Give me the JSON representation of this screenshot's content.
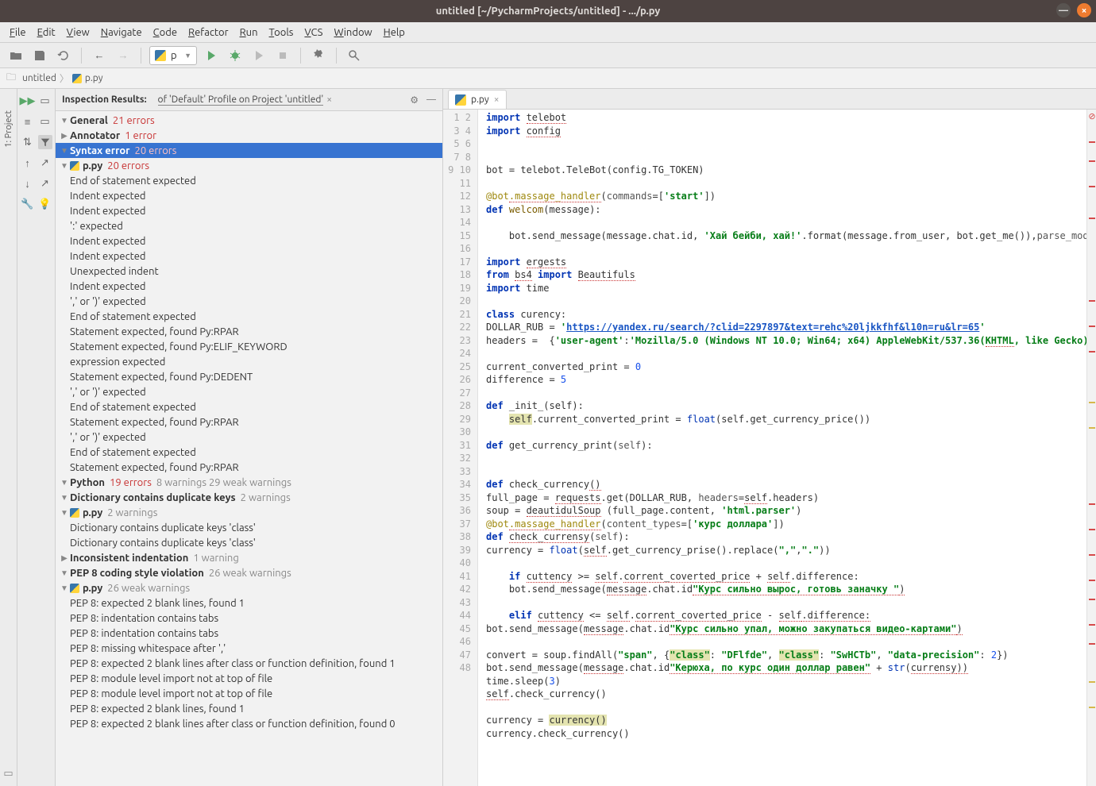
{
  "window": {
    "title": "untitled [~/PycharmProjects/untitled] - .../p.py"
  },
  "menu": [
    "File",
    "Edit",
    "View",
    "Navigate",
    "Code",
    "Refactor",
    "Run",
    "Tools",
    "VCS",
    "Window",
    "Help"
  ],
  "runConfig": "p",
  "breadcrumbs": [
    {
      "type": "folder",
      "label": "untitled"
    },
    {
      "type": "py",
      "label": "p.py"
    }
  ],
  "sidebar": {
    "project_tab": "1: Project"
  },
  "inspection": {
    "title": "Inspection Results:",
    "profile": "of 'Default' Profile on Project 'untitled'",
    "tree": [
      {
        "depth": 0,
        "arrow": "down",
        "label": "General",
        "err": "21 errors"
      },
      {
        "depth": 1,
        "arrow": "right",
        "label": "Annotator",
        "err": "1 error"
      },
      {
        "depth": 1,
        "arrow": "down",
        "label": "Syntax error",
        "err": "20 errors",
        "selected": true
      },
      {
        "depth": 2,
        "arrow": "down",
        "icon": "py",
        "label": "p.py",
        "err": "20 errors"
      },
      {
        "depth": 3,
        "label": "End of statement expected"
      },
      {
        "depth": 3,
        "label": "Indent expected"
      },
      {
        "depth": 3,
        "label": "Indent expected"
      },
      {
        "depth": 3,
        "label": "':' expected"
      },
      {
        "depth": 3,
        "label": "Indent expected"
      },
      {
        "depth": 3,
        "label": "Indent expected"
      },
      {
        "depth": 3,
        "label": "Unexpected indent"
      },
      {
        "depth": 3,
        "label": "Indent expected"
      },
      {
        "depth": 3,
        "label": "',' or ')' expected"
      },
      {
        "depth": 3,
        "label": "End of statement expected"
      },
      {
        "depth": 3,
        "label": "Statement expected, found Py:RPAR"
      },
      {
        "depth": 3,
        "label": "Statement expected, found Py:ELIF_KEYWORD"
      },
      {
        "depth": 3,
        "label": "expression expected"
      },
      {
        "depth": 3,
        "label": "Statement expected, found Py:DEDENT"
      },
      {
        "depth": 3,
        "label": "',' or ')' expected"
      },
      {
        "depth": 3,
        "label": "End of statement expected"
      },
      {
        "depth": 3,
        "label": "Statement expected, found Py:RPAR"
      },
      {
        "depth": 3,
        "label": "',' or ')' expected"
      },
      {
        "depth": 3,
        "label": "End of statement expected"
      },
      {
        "depth": 3,
        "label": "Statement expected, found Py:RPAR"
      },
      {
        "depth": 0,
        "arrow": "down",
        "label": "Python",
        "err": "19 errors",
        "warn": "8 warnings 29 weak warnings"
      },
      {
        "depth": 1,
        "arrow": "down",
        "label": "Dictionary contains duplicate keys",
        "warn": "2 warnings"
      },
      {
        "depth": 2,
        "arrow": "down",
        "icon": "py",
        "label": "p.py",
        "warn": "2 warnings"
      },
      {
        "depth": 3,
        "label": "Dictionary contains duplicate keys 'class'"
      },
      {
        "depth": 3,
        "label": "Dictionary contains duplicate keys 'class'"
      },
      {
        "depth": 1,
        "arrow": "right",
        "label": "Inconsistent indentation",
        "warn": "1 warning"
      },
      {
        "depth": 1,
        "arrow": "down",
        "label": "PEP 8 coding style violation",
        "warn": "26 weak warnings"
      },
      {
        "depth": 2,
        "arrow": "down",
        "icon": "py",
        "label": "p.py",
        "warn": "26 weak warnings"
      },
      {
        "depth": 3,
        "label": "PEP 8: expected 2 blank lines, found 1"
      },
      {
        "depth": 3,
        "label": "PEP 8: indentation contains tabs"
      },
      {
        "depth": 3,
        "label": "PEP 8: indentation contains tabs"
      },
      {
        "depth": 3,
        "label": "PEP 8: missing whitespace after ','"
      },
      {
        "depth": 3,
        "label": "PEP 8: expected 2 blank lines after class or function definition, found 1"
      },
      {
        "depth": 3,
        "label": "PEP 8: module level import not at top of file"
      },
      {
        "depth": 3,
        "label": "PEP 8: module level import not at top of file"
      },
      {
        "depth": 3,
        "label": "PEP 8: expected 2 blank lines, found 1"
      },
      {
        "depth": 3,
        "label": "PEP 8: expected 2 blank lines after class or function definition, found 0"
      }
    ]
  },
  "editor": {
    "tab": "p.py",
    "lines": [
      [
        {
          "t": "import ",
          "c": "kw"
        },
        {
          "t": "telebot",
          "c": "sq"
        }
      ],
      [
        {
          "t": "import ",
          "c": "kw"
        },
        {
          "t": "config",
          "c": "sq"
        }
      ],
      [],
      [],
      [
        {
          "t": "bot = telebot.TeleBot(config.TG_TOKEN)"
        }
      ],
      [],
      [
        {
          "t": "@bot",
          "c": "dec"
        },
        {
          "t": ".massage_handler",
          "c": "dec sq"
        },
        {
          "t": "(",
          "c": ""
        },
        {
          "t": "commands",
          "c": "op"
        },
        {
          "t": "=["
        },
        {
          "t": "'start'",
          "c": "str"
        },
        {
          "t": "])"
        }
      ],
      [
        {
          "t": "def ",
          "c": "kw"
        },
        {
          "t": "welcom",
          "c": "fn"
        },
        {
          "t": "(message):"
        }
      ],
      [],
      [
        {
          "t": "    bot.send_message(message.chat.id, "
        },
        {
          "t": "'Хай бейби, хай!'",
          "c": "ru"
        },
        {
          "t": ".format(message.from_user, bot.get_me()),"
        },
        {
          "t": "parse_mod",
          "c": "op"
        }
      ],
      [],
      [
        {
          "t": "import ",
          "c": "kw"
        },
        {
          "t": "ergests",
          "c": "sq"
        }
      ],
      [
        {
          "t": "from ",
          "c": "kw"
        },
        {
          "t": "bs4",
          "c": "sq"
        },
        {
          "t": " import ",
          "c": "kw"
        },
        {
          "t": "Beautifuls",
          "c": "sq"
        }
      ],
      [
        {
          "t": "import ",
          "c": "kw"
        },
        {
          "t": "time"
        }
      ],
      [],
      [
        {
          "t": "class ",
          "c": "kw"
        },
        {
          "t": "curency:"
        }
      ],
      [
        {
          "t": "DOLLAR_RUB = "
        },
        {
          "t": "'",
          "c": "str"
        },
        {
          "t": "https://yandex.ru/search/?clid=2297897&text=rehc%20ljkkfhf&l10n=ru&lr=65",
          "c": "link"
        },
        {
          "t": "'",
          "c": "str"
        }
      ],
      [
        {
          "t": "headers =  {"
        },
        {
          "t": "'user-agent'",
          "c": "str"
        },
        {
          "t": ":"
        },
        {
          "t": "'Mozilla/5.0 (Windows NT 10.0; Win64; x64) AppleWebKit/537.36(",
          "c": "str"
        },
        {
          "t": "KHTML",
          "c": "str sq"
        },
        {
          "t": ", like Gecko)",
          "c": "str"
        }
      ],
      [],
      [
        {
          "t": "current_converted_print = "
        },
        {
          "t": "0",
          "c": "num"
        }
      ],
      [
        {
          "t": "difference = "
        },
        {
          "t": "5",
          "c": "num"
        }
      ],
      [],
      [
        {
          "t": "def ",
          "c": "kw"
        },
        {
          "t": "_init_",
          "c": ""
        },
        {
          "t": "(self):"
        }
      ],
      [
        {
          "t": "    "
        },
        {
          "t": "self",
          "c": "hl"
        },
        {
          "t": ".current_converted_print = "
        },
        {
          "t": "float",
          "c": "bi"
        },
        {
          "t": "(self.get_currency_price())"
        }
      ],
      [],
      [
        {
          "t": "def ",
          "c": "kw"
        },
        {
          "t": "get_currency_print",
          "c": ""
        },
        {
          "t": "("
        },
        {
          "t": "self",
          "c": "op"
        },
        {
          "t": "):"
        }
      ],
      [],
      [],
      [
        {
          "t": "def ",
          "c": "kw"
        },
        {
          "t": "check_currency",
          "c": ""
        },
        {
          "t": "()",
          "c": "sq"
        }
      ],
      [
        {
          "t": "full_page = "
        },
        {
          "t": "requests",
          "c": "sq"
        },
        {
          "t": ".get(DOLLAR_RUB, "
        },
        {
          "t": "headers",
          "c": "op"
        },
        {
          "t": "="
        },
        {
          "t": "self",
          "c": "sq"
        },
        {
          "t": ".headers)"
        }
      ],
      [
        {
          "t": "soup = "
        },
        {
          "t": "deautidulSoup",
          "c": "sq"
        },
        {
          "t": " (full_page.content, "
        },
        {
          "t": "'html.parser'",
          "c": "str"
        },
        {
          "t": ")"
        }
      ],
      [
        {
          "t": "@bot",
          "c": "dec"
        },
        {
          "t": ".massage_handler",
          "c": "dec sq"
        },
        {
          "t": "("
        },
        {
          "t": "content_types",
          "c": "op"
        },
        {
          "t": "=["
        },
        {
          "t": "'курс доллара'",
          "c": "ru"
        },
        {
          "t": "])"
        }
      ],
      [
        {
          "t": "def ",
          "c": "kw"
        },
        {
          "t": "check_currensy",
          "c": "sq"
        },
        {
          "t": "("
        },
        {
          "t": "self",
          "c": "op"
        },
        {
          "t": "):"
        }
      ],
      [
        {
          "t": "currency = "
        },
        {
          "t": "float",
          "c": "bi"
        },
        {
          "t": "("
        },
        {
          "t": "self",
          "c": "sq"
        },
        {
          "t": ".get_currency_prise().replace("
        },
        {
          "t": "\",\"",
          "c": "str"
        },
        {
          "t": ","
        },
        {
          "t": "\".\"",
          "c": "str"
        },
        {
          "t": "))"
        }
      ],
      [],
      [
        {
          "t": "    if ",
          "c": "kw"
        },
        {
          "t": "cuttency",
          "c": "sq"
        },
        {
          "t": " >= "
        },
        {
          "t": "self",
          "c": "sq"
        },
        {
          "t": "."
        },
        {
          "t": "corrent_coverted_price",
          "c": "sq"
        },
        {
          "t": " + "
        },
        {
          "t": "self",
          "c": "sq"
        },
        {
          "t": ".difference:"
        }
      ],
      [
        {
          "t": "    bot.send_message("
        },
        {
          "t": "message",
          "c": "sq"
        },
        {
          "t": ".chat.id"
        },
        {
          "t": "\"Курс сильно вырос, готовь заначку \"",
          "c": "ru sq"
        },
        {
          "t": ")",
          "c": "sq"
        }
      ],
      [],
      [
        {
          "t": "    elif ",
          "c": "kw"
        },
        {
          "t": "cuttency",
          "c": "sq"
        },
        {
          "t": " <= "
        },
        {
          "t": "self",
          "c": "sq"
        },
        {
          "t": "."
        },
        {
          "t": "corrent_coverted_price",
          "c": "sq"
        },
        {
          "t": " - "
        },
        {
          "t": "self",
          "c": "sq"
        },
        {
          "t": ".difference:",
          "c": "sq"
        }
      ],
      [
        {
          "t": "bot.send_message("
        },
        {
          "t": "message",
          "c": "sq"
        },
        {
          "t": ".chat.id"
        },
        {
          "t": "\"Курс сильно упал, можно закупаться видео-картами\"",
          "c": "ru sq"
        },
        {
          "t": ")",
          "c": "sq"
        }
      ],
      [],
      [
        {
          "t": "convert = soup.findAll("
        },
        {
          "t": "\"span\"",
          "c": "str"
        },
        {
          "t": ", {"
        },
        {
          "t": "\"class\"",
          "c": "str hl"
        },
        {
          "t": ": "
        },
        {
          "t": "\"DFlfde\"",
          "c": "str"
        },
        {
          "t": ", "
        },
        {
          "t": "\"class\"",
          "c": "str hl"
        },
        {
          "t": ": "
        },
        {
          "t": "\"SwHCTb\"",
          "c": "str"
        },
        {
          "t": ", "
        },
        {
          "t": "\"data-precision\"",
          "c": "str"
        },
        {
          "t": ": "
        },
        {
          "t": "2",
          "c": "num"
        },
        {
          "t": "})"
        }
      ],
      [
        {
          "t": "bot.send_message("
        },
        {
          "t": "message",
          "c": "sq"
        },
        {
          "t": ".chat.id"
        },
        {
          "t": "\"Керюха, по курс один доллар равен\"",
          "c": "ru sq"
        },
        {
          "t": " + "
        },
        {
          "t": "str",
          "c": "bi"
        },
        {
          "t": "("
        },
        {
          "t": "currensy",
          "c": "sq"
        },
        {
          "t": "))",
          "c": "sq"
        }
      ],
      [
        {
          "t": "time.sleep("
        },
        {
          "t": "3",
          "c": "num"
        },
        {
          "t": ")"
        }
      ],
      [
        {
          "t": "self",
          "c": "sq"
        },
        {
          "t": ".check_currency()"
        }
      ],
      [],
      [
        {
          "t": "currency = "
        },
        {
          "t": "currency()",
          "c": "hl"
        }
      ],
      [
        {
          "t": "currency.check_currency()"
        }
      ]
    ],
    "stripe_errors": [
      3,
      6,
      10,
      15,
      28,
      32,
      36,
      60,
      64,
      68,
      72,
      75,
      79,
      82
    ],
    "stripe_warns": [
      44,
      48,
      88,
      92
    ]
  }
}
